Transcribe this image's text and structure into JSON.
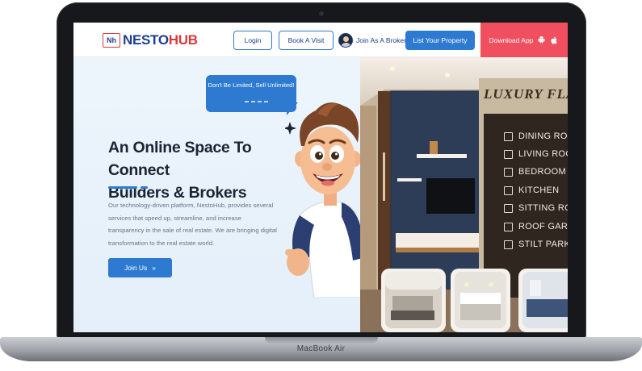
{
  "laptop": {
    "label": "MacBook Air"
  },
  "header": {
    "logo_left": "NESTO",
    "logo_right": "HUB",
    "logo_mark": "Nh",
    "login_label": "Login",
    "visit_label": "Book A Visit",
    "broker_label": "Join As A Broker",
    "list_label": "List Your Property",
    "download_label": "Download App"
  },
  "hero": {
    "bubble_text": "Don't Be Limited, Sell Unlimited!",
    "headline_line1": "An Online Space To Connect",
    "headline_line2": "Builders & Brokers",
    "description": "Our technology-driven platform, NestoHub, provides several services that speed up, streamline, and increase transparency in the sale of real estate. We are bringing digital transformation to the real estate world.",
    "join_label": "Join Us",
    "join_arrow": "»"
  },
  "banner": {
    "title": "LUXURY FLA",
    "items": [
      {
        "label": "DINING ROOM"
      },
      {
        "label": "LIVING ROOM"
      },
      {
        "label": "BEDROOM"
      },
      {
        "label": "KITCHEN"
      },
      {
        "label": "SITTING ROO"
      },
      {
        "label": "ROOF GARDE"
      },
      {
        "label": "STILT PARKIN"
      }
    ]
  },
  "colors": {
    "brand_blue": "#2e7ad1",
    "brand_navy": "#1d3f8f",
    "download_red": "#ef4f5e",
    "banner_brown": "#3a2c1c"
  },
  "icons": {
    "android": "android-icon",
    "apple": "apple-icon"
  }
}
